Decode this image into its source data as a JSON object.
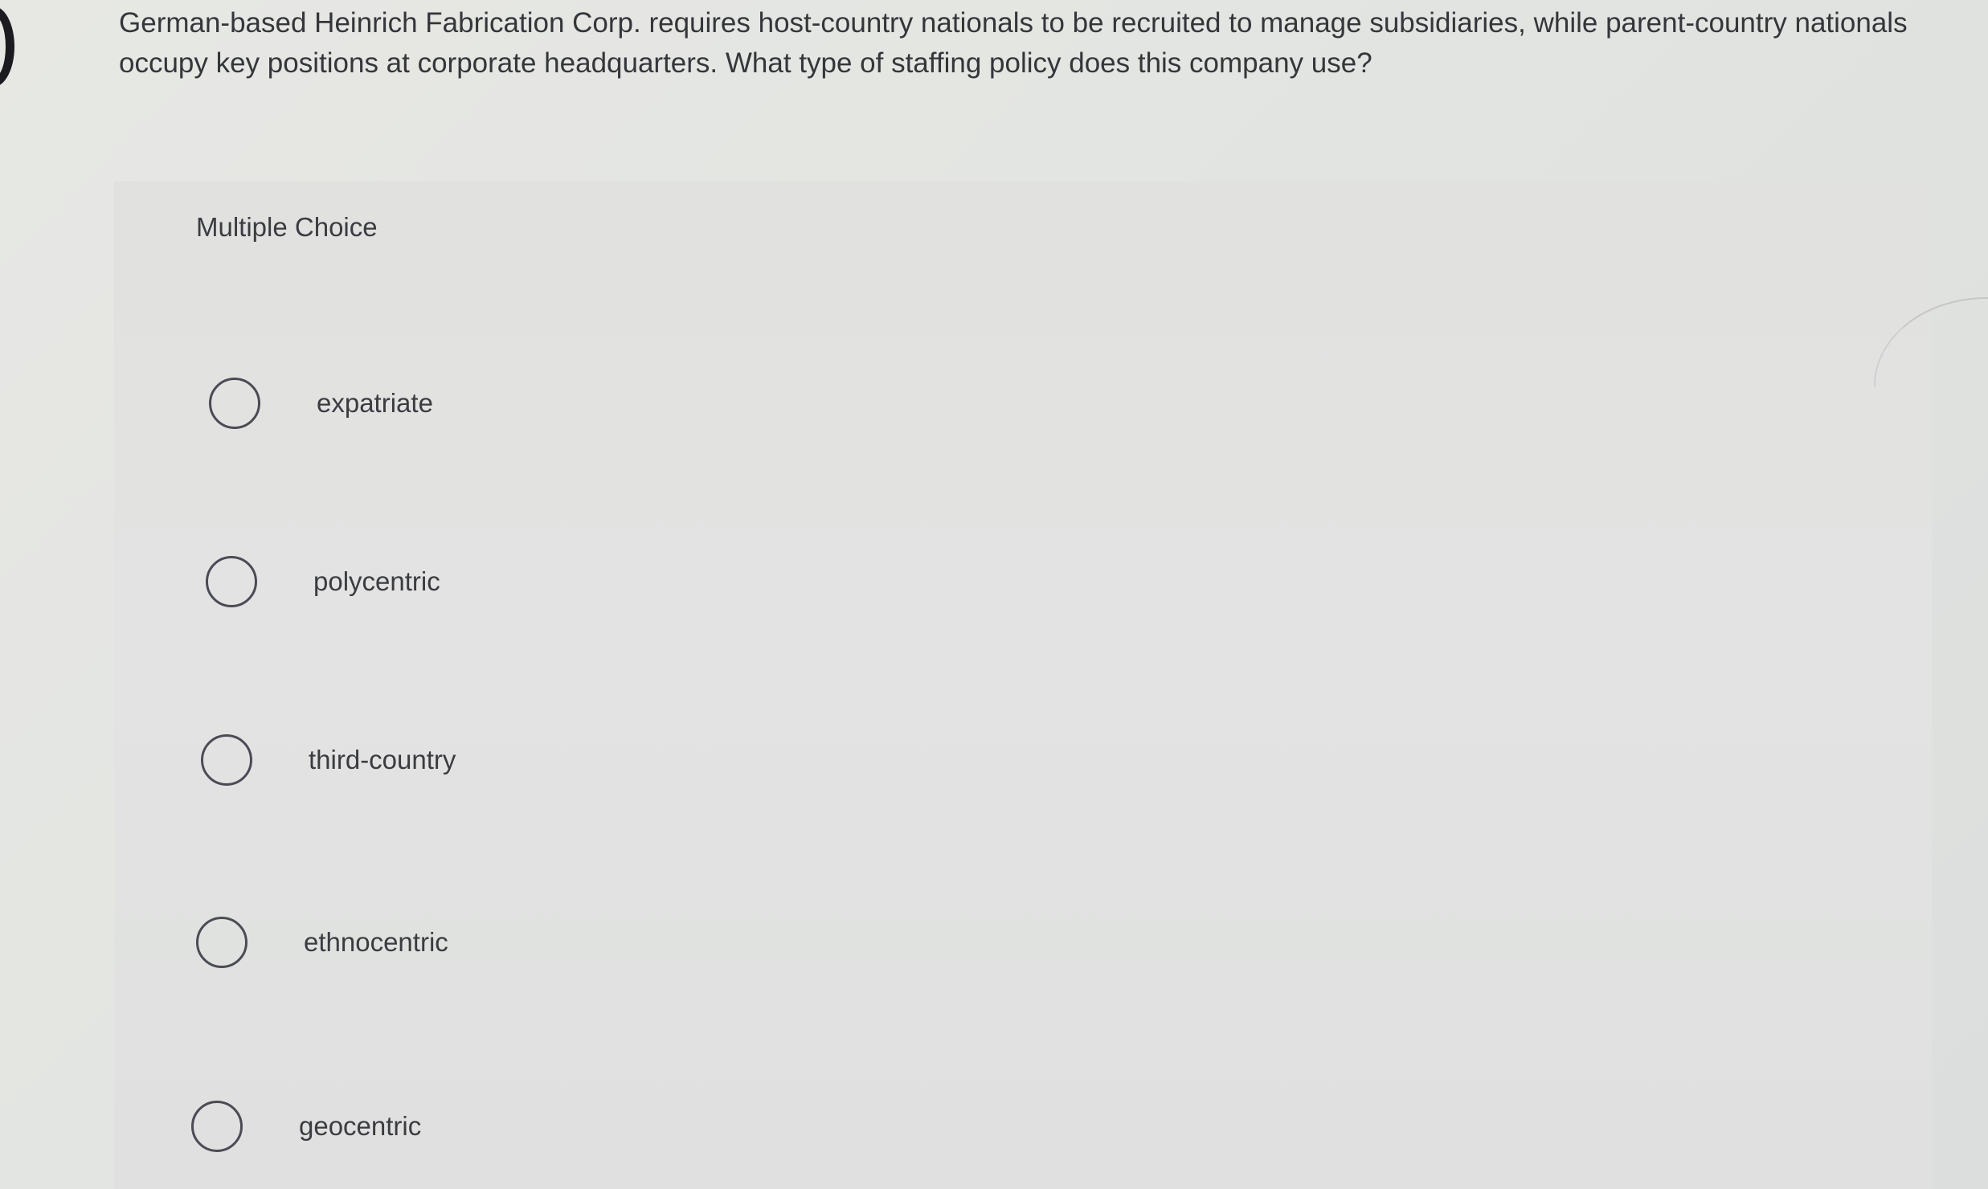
{
  "question": {
    "text": "German-based Heinrich Fabrication Corp. requires host-country nationals to be recruited to manage subsidiaries, while parent-country nationals occupy key positions at corporate headquarters. What type of staffing policy does this company use?"
  },
  "choices": {
    "heading": "Multiple Choice",
    "options": [
      {
        "label": "expatriate",
        "selected": false
      },
      {
        "label": "polycentric",
        "selected": false
      },
      {
        "label": "third-country",
        "selected": false
      },
      {
        "label": "ethnocentric",
        "selected": false
      },
      {
        "label": "geocentric",
        "selected": false
      }
    ]
  }
}
